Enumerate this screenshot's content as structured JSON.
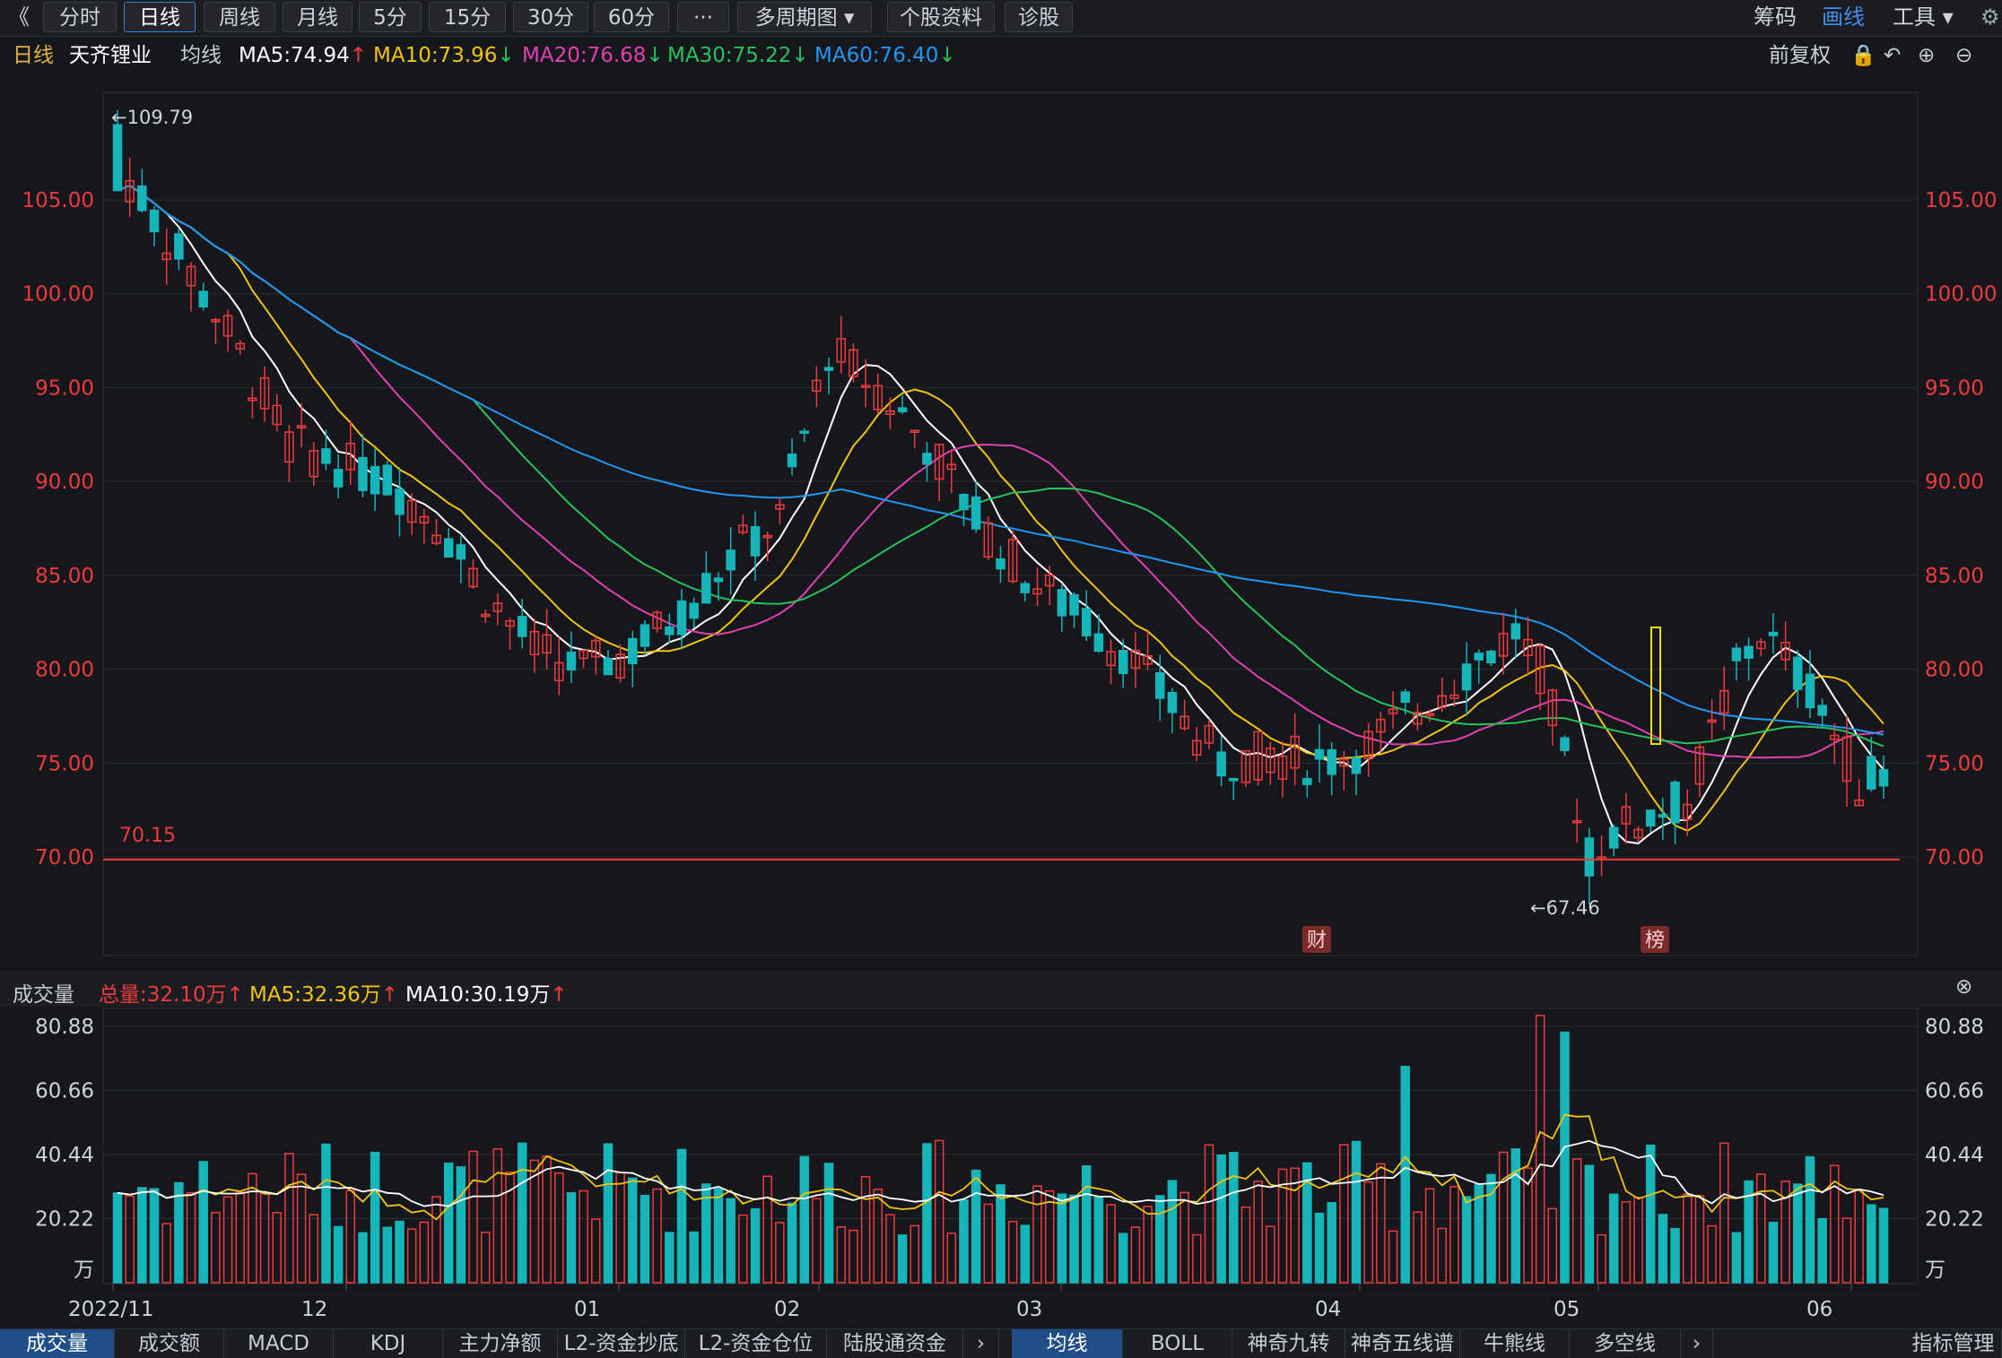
{
  "toolbar": {
    "back": "《",
    "periods": [
      "分时",
      "日线",
      "周线",
      "月线",
      "5分",
      "15分",
      "30分",
      "60分",
      "···",
      "多周期图 ▾",
      "个股资料",
      "诊股"
    ],
    "active": 1,
    "right": [
      "筹码",
      "画线",
      "工具 ▾"
    ]
  },
  "legend": {
    "period": "日线",
    "stock": "天齐锂业",
    "ma_label": "均线",
    "ma5": "MA5:74.94",
    "ma10": "MA10:73.96",
    "ma20": "MA20:76.68",
    "ma30": "MA30:75.22",
    "ma60": "MA60:76.40",
    "fq": "前复权"
  },
  "volume_legend": {
    "title": "成交量",
    "total": "总量:32.10万",
    "ma5": "MA5:32.36万",
    "ma10": "MA10:30.19万"
  },
  "bottom_tabs": {
    "left": [
      "成交量",
      "成交额",
      "MACD",
      "KDJ",
      "主力净额",
      "L2-资金抄底",
      "L2-资金仓位",
      "陆股通资金"
    ],
    "right": [
      "均线",
      "BOLL",
      "神奇九转",
      "神奇五线谱",
      "牛熊线",
      "多空线"
    ],
    "last": "指标管理"
  },
  "colors": {
    "up": "#ee3b3b",
    "down": "#16b5b9",
    "ma5": "#ffffff",
    "ma10": "#f1c40f",
    "ma20": "#e040b0",
    "ma30": "#26c35a",
    "ma60": "#2196f3",
    "grid": "#2a2d33"
  },
  "chart_data": {
    "type": "candlestick",
    "yticks": [
      "105.00",
      "100.00",
      "95.00",
      "90.00",
      "85.00",
      "80.00",
      "75.00",
      "70.00"
    ],
    "ylim": [
      67.46,
      109.79
    ],
    "xticks": [
      "2022/11",
      "12",
      "01",
      "02",
      "03",
      "04",
      "05",
      "06"
    ],
    "annotations": {
      "high": "←109.79",
      "low": "←67.46",
      "support": "70.15",
      "badge1": "财",
      "badge2": "榜"
    },
    "vol_yticks": [
      "80.88",
      "60.66",
      "40.44",
      "20.22",
      "万"
    ],
    "vol_ylim": [
      0,
      80.88
    ],
    "series_names": {
      "ma5": "MA5",
      "ma10": "MA10",
      "ma20": "MA20",
      "ma30": "MA30",
      "ma60": "MA60"
    }
  }
}
